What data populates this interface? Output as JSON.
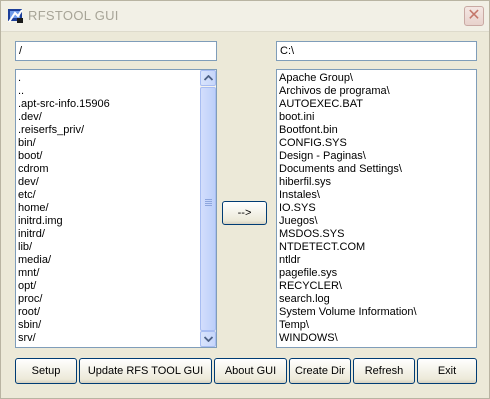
{
  "window": {
    "title": "RFSTOOL GUI"
  },
  "left_panel": {
    "path": "/",
    "items": [
      ".",
      "..",
      ".apt-src-info.15906",
      ".dev/",
      ".reiserfs_priv/",
      "bin/",
      "boot/",
      "cdrom",
      "dev/",
      "etc/",
      "home/",
      "initrd.img",
      "initrd/",
      "lib/",
      "media/",
      "mnt/",
      "opt/",
      "proc/",
      "root/",
      "sbin/",
      "srv/"
    ]
  },
  "right_panel": {
    "path": "C:\\",
    "items": [
      "Apache Group\\",
      "Archivos de programa\\",
      "AUTOEXEC.BAT",
      "boot.ini",
      "Bootfont.bin",
      "CONFIG.SYS",
      "Design - Paginas\\",
      "Documents and Settings\\",
      "hiberfil.sys",
      "Instales\\",
      "IO.SYS",
      "Juegos\\",
      "MSDOS.SYS",
      "NTDETECT.COM",
      "ntldr",
      "pagefile.sys",
      "RECYCLER\\",
      "search.log",
      "System Volume Information\\",
      "Temp\\",
      "WINDOWS\\"
    ]
  },
  "transfer_button": {
    "label": "-->"
  },
  "toolbar": {
    "setup": "Setup",
    "update": "Update RFS TOOL GUI",
    "about": "About GUI",
    "create_dir": "Create Dir",
    "refresh": "Refresh",
    "exit": "Exit"
  },
  "icons": {
    "close": "close-icon",
    "app": "app-icon",
    "scroll_up": "arrow-up-icon",
    "scroll_down": "arrow-down-icon"
  }
}
